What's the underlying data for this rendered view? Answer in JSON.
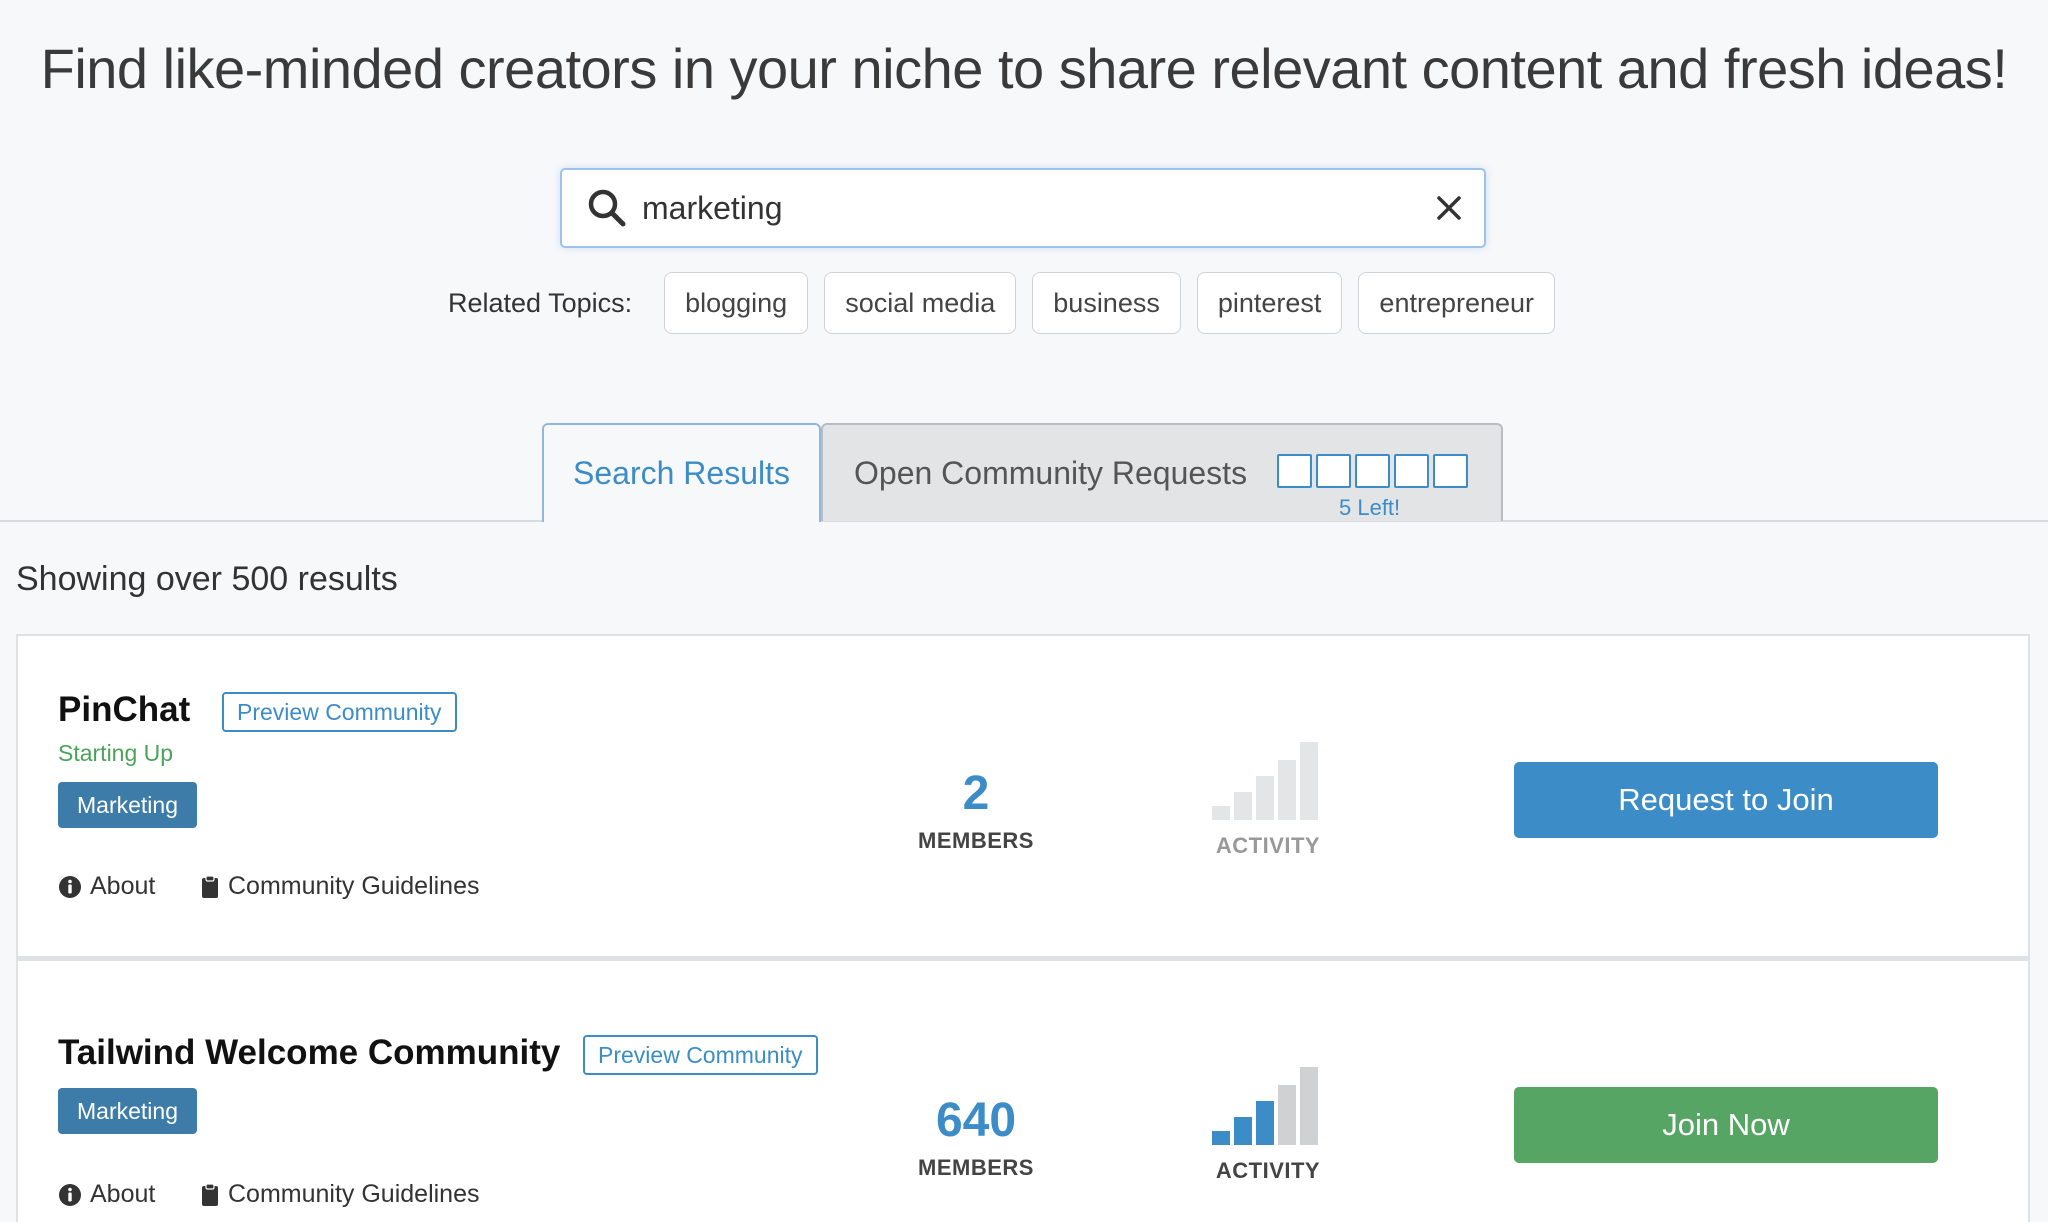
{
  "headline": "Find like-minded creators in your niche to share relevant content and fresh ideas!",
  "search": {
    "value": "marketing",
    "placeholder": ""
  },
  "related": {
    "label": "Related Topics:",
    "topics": [
      "blogging",
      "social media",
      "business",
      "pinterest",
      "entrepreneur"
    ]
  },
  "tabs": {
    "search_results": "Search Results",
    "open_requests": "Open Community Requests",
    "requests_left": "5 Left!",
    "slots_total": 5
  },
  "results_count": "Showing over 500 results",
  "communities": [
    {
      "name": "PinChat",
      "preview_label": "Preview Community",
      "status": "Starting Up",
      "tag": "Marketing",
      "about_label": "About",
      "guidelines_label": "Community Guidelines",
      "members": "2",
      "members_label": "MEMBERS",
      "activity_label": "ACTIVITY",
      "activity_level": 0,
      "action_label": "Request to Join"
    },
    {
      "name": "Tailwind Welcome Community",
      "preview_label": "Preview Community",
      "status": "",
      "tag": "Marketing",
      "about_label": "About",
      "guidelines_label": "Community Guidelines",
      "members": "640",
      "members_label": "MEMBERS",
      "activity_label": "ACTIVITY",
      "activity_level": 3,
      "action_label": "Join Now"
    }
  ],
  "colors": {
    "accent_blue": "#3c8dc7",
    "tag_blue": "#3d7ba8",
    "join_green": "#56a564",
    "status_green": "#4aa35a",
    "activity_inactive": "#e4e5e7",
    "activity_empty": "#cfd1d3"
  },
  "icons": {
    "search": "search-icon",
    "clear": "close-icon",
    "about": "info-icon",
    "guidelines": "clipboard-icon",
    "activity": "signal-bars-icon"
  }
}
